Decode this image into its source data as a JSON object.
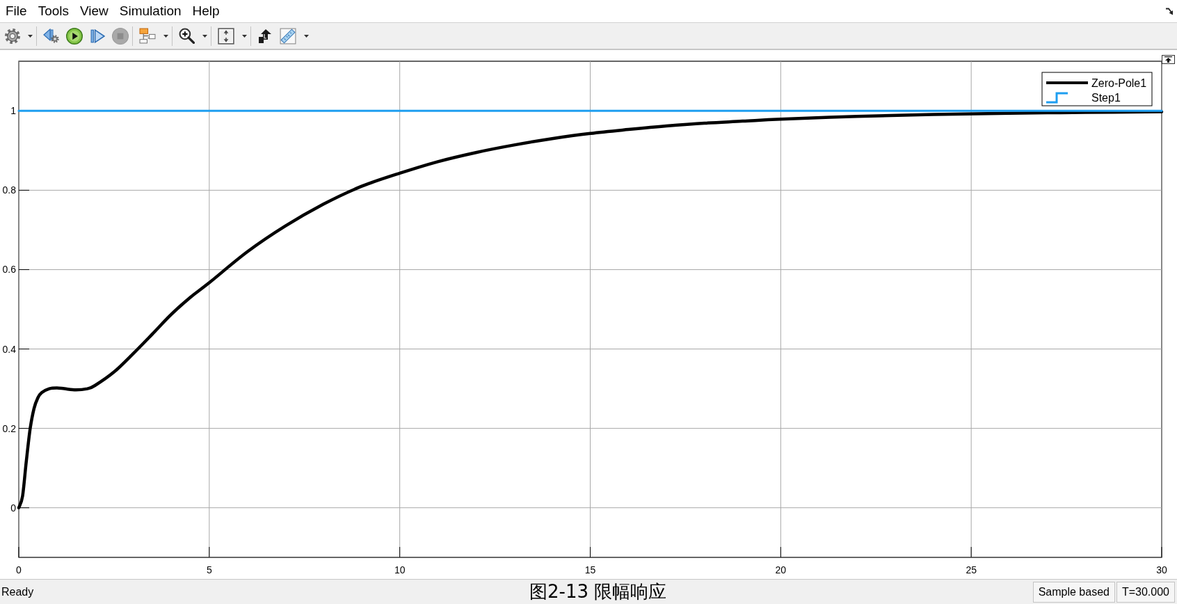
{
  "menu": [
    "File",
    "Tools",
    "View",
    "Simulation",
    "Help"
  ],
  "toolbar": [
    {
      "tools": [
        {
          "kind": "settings",
          "disabled": false,
          "dropdown": true
        }
      ]
    },
    {
      "tools": [
        {
          "kind": "step_back",
          "disabled": false,
          "dropdown": false
        },
        {
          "kind": "run",
          "disabled": false,
          "dropdown": false
        },
        {
          "kind": "step_forward",
          "disabled": false,
          "dropdown": false
        },
        {
          "kind": "stop",
          "disabled": true,
          "dropdown": false
        }
      ]
    },
    {
      "tools": [
        {
          "kind": "blocks",
          "disabled": false,
          "dropdown": true
        }
      ]
    },
    {
      "tools": [
        {
          "kind": "zoom",
          "disabled": false,
          "dropdown": true
        }
      ]
    },
    {
      "tools": [
        {
          "kind": "autoscale",
          "disabled": false,
          "dropdown": true
        }
      ]
    },
    {
      "tools": [
        {
          "kind": "highlight",
          "disabled": false,
          "dropdown": false
        },
        {
          "kind": "measure",
          "disabled": false,
          "dropdown": true
        }
      ]
    }
  ],
  "scope": {
    "chart_data": {
      "type": "line",
      "x": [
        0,
        0.1,
        0.2,
        0.3,
        0.4,
        0.5,
        0.6,
        0.8,
        1,
        1.2,
        1.5,
        1.8,
        2,
        2.5,
        3,
        3.5,
        4,
        4.5,
        5,
        6,
        7,
        8,
        9,
        10,
        11,
        12,
        13,
        14,
        15,
        16,
        17,
        18,
        19,
        20,
        22,
        24,
        26,
        28,
        30
      ],
      "series": [
        {
          "name": "Zero-Pole1",
          "color": "#000000",
          "values": [
            0,
            0.03,
            0.12,
            0.2,
            0.25,
            0.277,
            0.29,
            0.3,
            0.302,
            0.3,
            0.297,
            0.3,
            0.308,
            0.342,
            0.388,
            0.437,
            0.487,
            0.53,
            0.567,
            0.645,
            0.71,
            0.765,
            0.81,
            0.843,
            0.872,
            0.895,
            0.914,
            0.93,
            0.943,
            0.953,
            0.962,
            0.969,
            0.974,
            0.979,
            0.986,
            0.991,
            0.994,
            0.996,
            0.998
          ]
        },
        {
          "name": "Step1",
          "color": "#1e9ef0",
          "values": [
            1,
            1,
            1,
            1,
            1,
            1,
            1,
            1,
            1,
            1,
            1,
            1,
            1,
            1,
            1,
            1,
            1,
            1,
            1,
            1,
            1,
            1,
            1,
            1,
            1,
            1,
            1,
            1,
            1,
            1,
            1,
            1,
            1,
            1,
            1,
            1,
            1,
            1,
            1
          ]
        }
      ],
      "xlim": [
        0,
        30
      ],
      "ylim": [
        -0.125,
        1.125
      ],
      "xticks": [
        0,
        5,
        10,
        15,
        20,
        25,
        30
      ],
      "yticks": [
        0,
        0.2,
        0.4,
        0.6,
        0.8,
        1
      ],
      "grid": true,
      "legend": true
    }
  },
  "status_bar": {
    "status": "Ready",
    "caption": "图2-13 限幅响应",
    "fields": [
      "Sample based",
      "T=30.000"
    ]
  }
}
